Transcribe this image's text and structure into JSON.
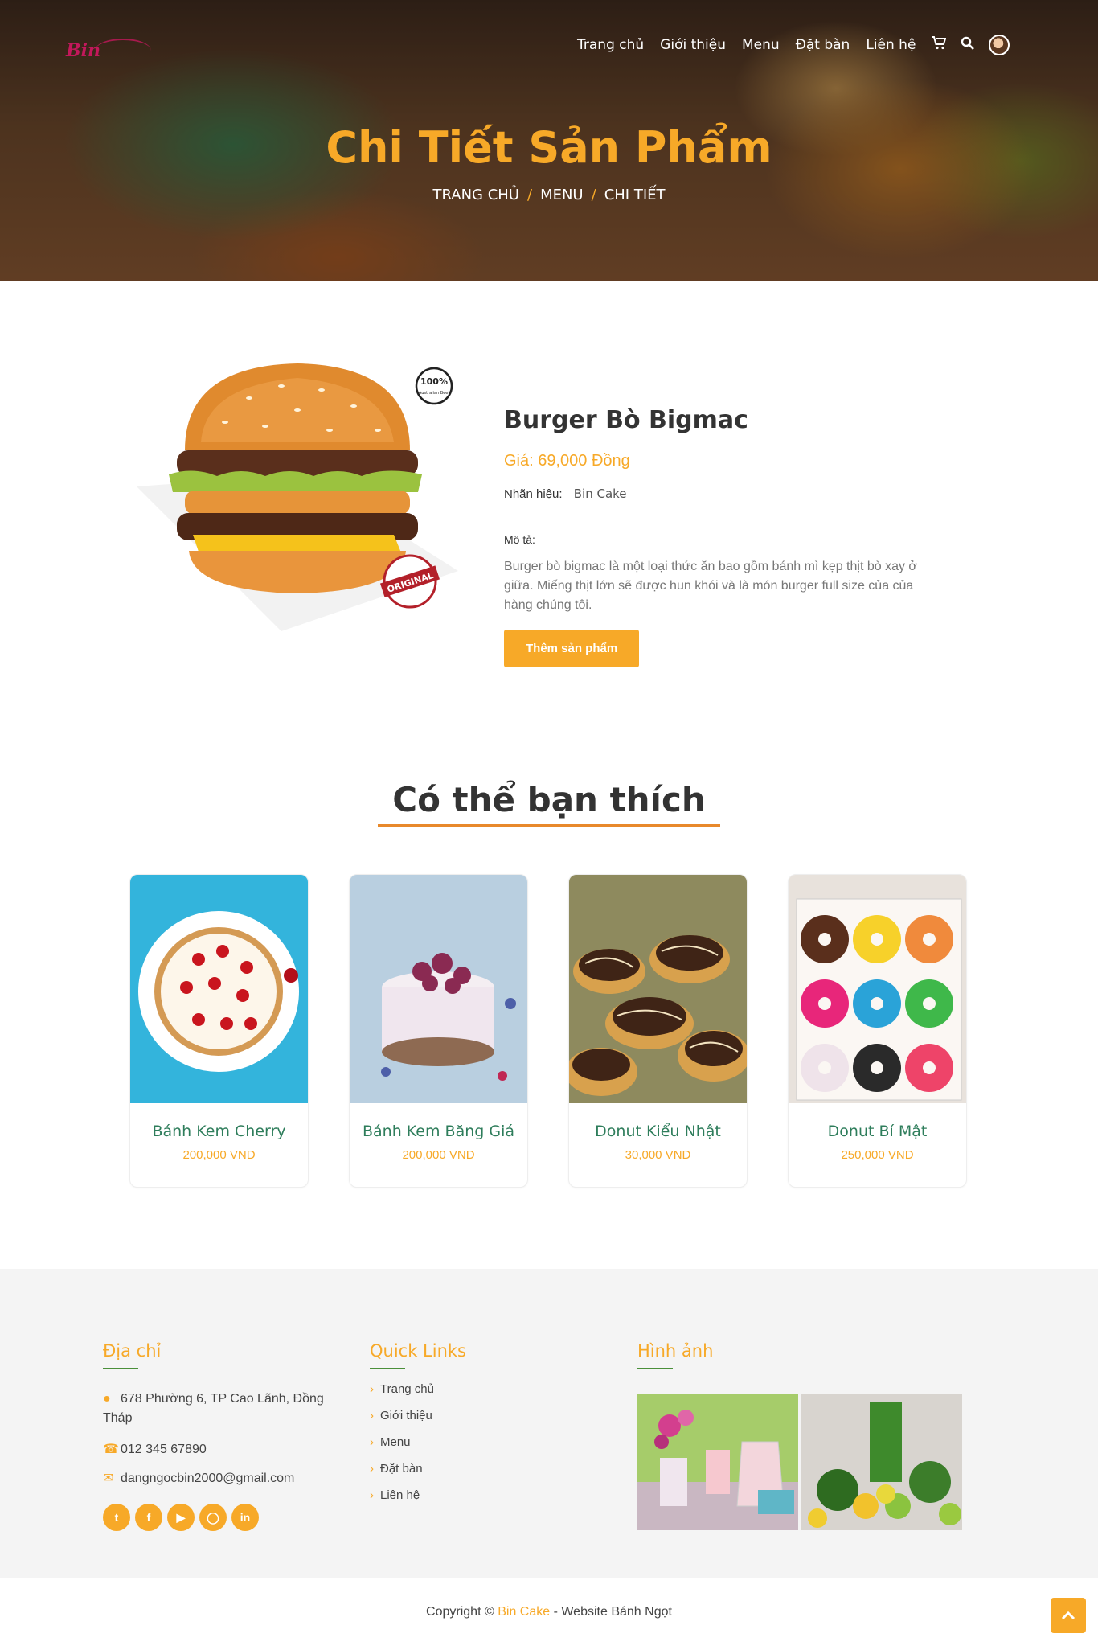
{
  "header": {
    "logo_text": "Bin",
    "nav": [
      "Trang chủ",
      "Giới thiệu",
      "Menu",
      "Đặt bàn",
      "Liên hệ"
    ],
    "icons": [
      "cart-icon",
      "search-icon",
      "avatar"
    ]
  },
  "hero": {
    "title": "Chi Tiết Sản Phẩm",
    "breadcrumb": [
      "TRANG CHỦ",
      "MENU",
      "CHI TIẾT"
    ],
    "separator": "/"
  },
  "product": {
    "name": "Burger Bò Bigmac",
    "price": "Giá: 69,000 Đồng",
    "brand_label": "Nhãn hiệu:",
    "brand_value": "Bin Cake",
    "desc_label": "Mô tả:",
    "description": "Burger bò bigmac là một loại thức ăn bao gồm bánh mì kẹp thịt bò xay ở giữa. Miếng thịt lớn sẽ được hun khói và là món burger full size của của hàng chúng tôi.",
    "add_button": "Thêm sản phẩm",
    "badge_top": "100%",
    "badge_top_sub": "Australian Beef",
    "badge_bottom": "ORIGINAL"
  },
  "suggest": {
    "title": "Có thể bạn thích",
    "items": [
      {
        "name": "Bánh Kem Cherry",
        "price": "200,000 VND"
      },
      {
        "name": "Bánh Kem Băng Giá",
        "price": "200,000 VND"
      },
      {
        "name": "Donut Kiểu Nhật",
        "price": "30,000 VND"
      },
      {
        "name": "Donut Bí Mật",
        "price": "250,000 VND"
      }
    ]
  },
  "footer": {
    "address_title": "Địa chỉ",
    "address": "678 Phường 6, TP Cao Lãnh, Đồng Tháp",
    "phone": "012 345 67890",
    "email": "dangngocbin2000@gmail.com",
    "socials": [
      "twitter-icon",
      "facebook-icon",
      "youtube-icon",
      "instagram-icon",
      "linkedin-icon"
    ],
    "links_title": "Quick Links",
    "links": [
      "Trang chủ",
      "Giới thiệu",
      "Menu",
      "Đặt bàn",
      "Liên hệ"
    ],
    "gallery_title": "Hình ảnh",
    "copyright_prefix": "Copyright ©",
    "copyright_brand": "Bin Cake",
    "copyright_suffix": "- Website Bánh Ngọt"
  },
  "colors": {
    "accent": "#f7a928",
    "green_text": "#2e7d5b",
    "underline": "#e8892b"
  }
}
